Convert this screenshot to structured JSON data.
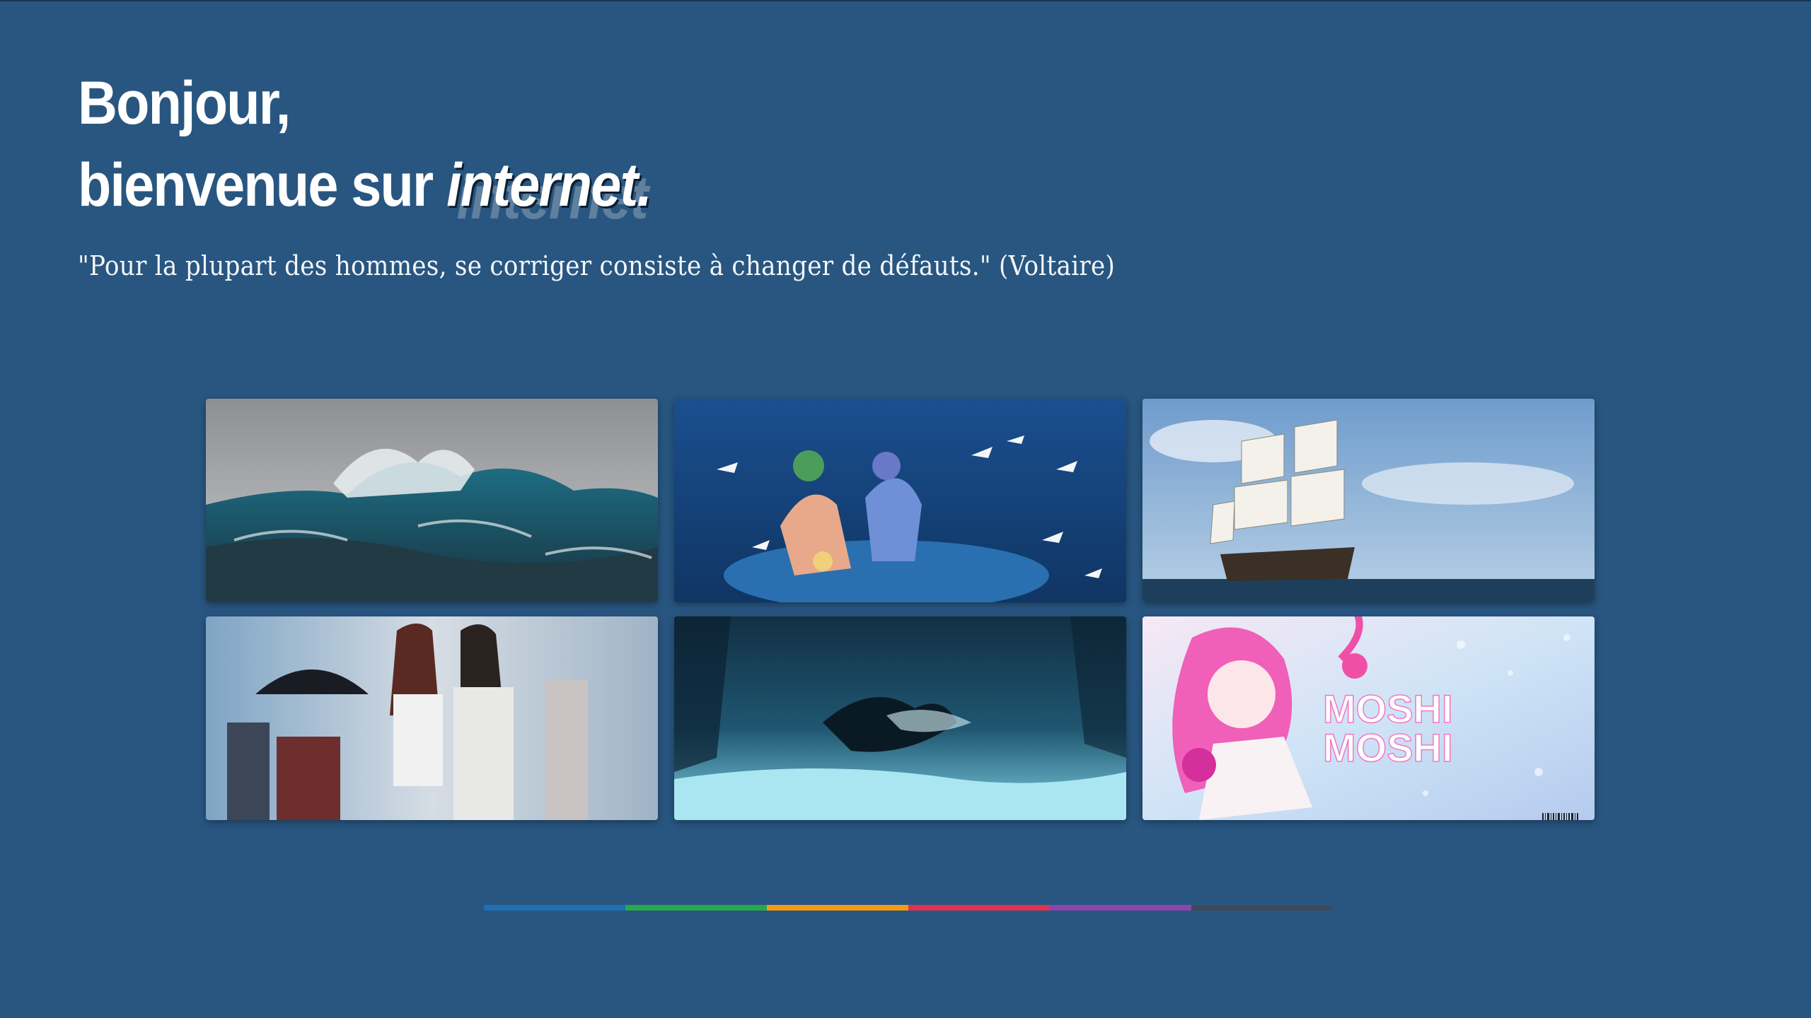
{
  "greeting": {
    "line1": "Bonjour,",
    "line2_prefix": "bienvenue sur ",
    "accent_word": "internet",
    "accent_dot": "."
  },
  "quote": "\"Pour la plupart des hommes, se corriger consiste à changer de défauts.\" (Voltaire)",
  "gallery": {
    "tiles": [
      {
        "name": "stormy-sea-tile"
      },
      {
        "name": "anime-girls-fishing-tile"
      },
      {
        "name": "sailing-ship-tile"
      },
      {
        "name": "anime-group-umbrella-tile"
      },
      {
        "name": "dark-wave-painting-tile"
      },
      {
        "name": "moshi-moshi-tile",
        "art_text_1": "MOSHI",
        "art_text_2": "MOSHI"
      }
    ]
  },
  "colors": {
    "background": "#285680",
    "bar_segments": [
      "#1f6fb2",
      "#27a84a",
      "#f39c12",
      "#e0334f",
      "#8e44ad",
      "#3d4a5c"
    ]
  }
}
